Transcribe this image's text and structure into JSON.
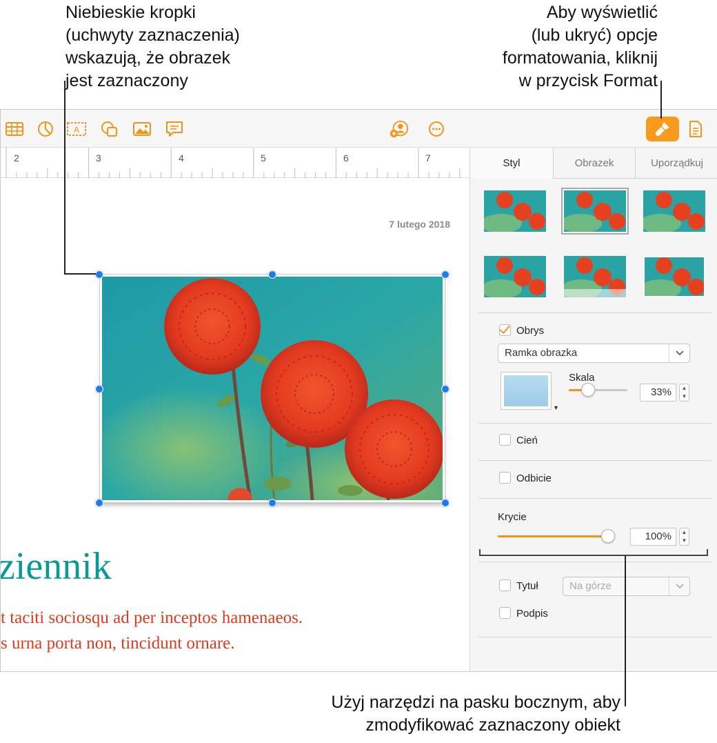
{
  "callouts": {
    "top_left": [
      "Niebieskie kropki",
      "(uchwyty zaznaczenia)",
      "wskazują, że obrazek",
      "jest zaznaczony"
    ],
    "top_right": [
      "Aby wyświetlić",
      "(lub ukryć) opcje",
      "formatowania, kliknij",
      "w przycisk Format"
    ],
    "bottom_right": [
      "Użyj narzędzi na pasku bocznym, aby",
      "zmodyfikować zaznaczony obiekt"
    ]
  },
  "toolbar": {
    "icons": [
      "table-icon",
      "chart-icon",
      "text-box-icon",
      "shape-icon",
      "media-icon",
      "comment-icon",
      "collaborate-icon",
      "more-icon",
      "format-brush-icon",
      "document-icon"
    ],
    "accent": "#f79a1e"
  },
  "ruler": {
    "numbers": [
      "2",
      "3",
      "4",
      "5",
      "6",
      "7"
    ]
  },
  "document": {
    "date": "7 lutego 2018",
    "title": "ziennik",
    "body_lines": [
      "t taciti sociosqu ad per inceptos hamenaeos.",
      "s urna porta non, tincidunt ornare."
    ],
    "title_color": "#0a9a96",
    "body_color": "#e03a1e"
  },
  "sidebar": {
    "tabs": [
      "Styl",
      "Obrazek",
      "Uporządkuj"
    ],
    "active_tab": "Styl",
    "border": {
      "label": "Obrys",
      "checked": true,
      "style_value": "Ramka obrazka",
      "scale_label": "Skala",
      "scale_value": "33%",
      "scale_level": 0.33
    },
    "shadow": {
      "label": "Cień",
      "checked": false
    },
    "reflection": {
      "label": "Odbicie",
      "checked": false
    },
    "opacity": {
      "label": "Krycie",
      "value": "100%",
      "level": 1.0
    },
    "title": {
      "label": "Tytuł",
      "checked": false,
      "position_value": "Na górze"
    },
    "caption": {
      "label": "Podpis",
      "checked": false
    }
  }
}
